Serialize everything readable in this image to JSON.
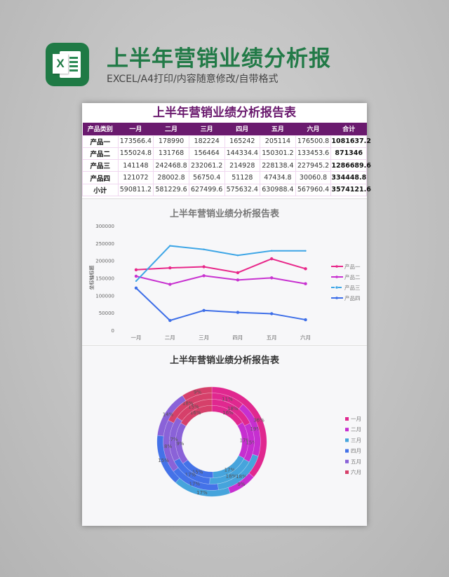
{
  "header": {
    "title": "上半年营销业绩分析报",
    "subtitle": "EXCEL/A4打印/内容随意修改/自带格式",
    "logo_text": "X"
  },
  "table": {
    "title": "上半年营销业绩分析报告表",
    "columns": [
      "产品类别",
      "一月",
      "二月",
      "三月",
      "四月",
      "五月",
      "六月",
      "合计"
    ],
    "rows": [
      [
        "产品一",
        "173566.4",
        "178990",
        "182224",
        "165242",
        "205114",
        "176500.8",
        "1081637.2"
      ],
      [
        "产品二",
        "155024.8",
        "131768",
        "156464",
        "144334.4",
        "150301.2",
        "133453.6",
        "871346"
      ],
      [
        "产品三",
        "141148",
        "242468.8",
        "232061.2",
        "214928",
        "228138.4",
        "227945.2",
        "1286689.6"
      ],
      [
        "产品四",
        "121072",
        "28002.8",
        "56750.4",
        "51128",
        "47434.8",
        "30060.8",
        "334448.8"
      ],
      [
        "小计",
        "590811.2",
        "581229.6",
        "627499.6",
        "575632.4",
        "630988.4",
        "567960.4",
        "3574121.6"
      ]
    ]
  },
  "chart_data": [
    {
      "type": "line",
      "title": "上半年营销业绩分析报告表",
      "ylabel": "坐标轴标题",
      "ylim": [
        0,
        300000
      ],
      "yticks": [
        "0",
        "50000",
        "100000",
        "150000",
        "200000",
        "250000",
        "300000"
      ],
      "categories": [
        "一月",
        "二月",
        "三月",
        "四月",
        "五月",
        "六月"
      ],
      "grid": false,
      "legend": "right",
      "series": [
        {
          "name": "产品一",
          "color": "#e8288a",
          "values": [
            173566.4,
            178990,
            182224,
            165242,
            205114,
            176500.8
          ]
        },
        {
          "name": "产品二",
          "color": "#c832d0",
          "values": [
            155024.8,
            131768,
            156464,
            144334.4,
            150301.2,
            133453.6
          ]
        },
        {
          "name": "产品三",
          "color": "#3ea6e6",
          "dash": true,
          "values": [
            141148,
            242468.8,
            232061.2,
            214928,
            228138.4,
            227945.2
          ]
        },
        {
          "name": "产品四",
          "color": "#3d6ee8",
          "values": [
            121072,
            28002.8,
            56750.4,
            51128,
            47434.8,
            30060.8
          ]
        }
      ]
    },
    {
      "type": "pie",
      "subtype": "multi-ring donut",
      "title": "上半年营销业绩分析报告表",
      "legend": "right",
      "categories": [
        "一月",
        "二月",
        "三月",
        "四月",
        "五月",
        "六月"
      ],
      "colors": [
        "#e0288f",
        "#c62fd0",
        "#46a4dc",
        "#4472e8",
        "#8a62d8",
        "#d6406a"
      ],
      "rings_inner_to_outer": [
        {
          "name": "产品一",
          "labels": [
            "16%",
            "17%",
            "17%",
            "15%",
            "19%",
            "16%"
          ]
        },
        {
          "name": "产品二",
          "labels": [
            "18%",
            "15%",
            "18%",
            "17%",
            "17%",
            "15%"
          ]
        },
        {
          "name": "产品三",
          "labels": [
            "11%",
            "19%",
            "18%",
            "17%",
            "18%",
            "18%"
          ]
        },
        {
          "name": "产品四",
          "labels": [
            "36%",
            "9%",
            "17%",
            "15%",
            "14%",
            "9%"
          ]
        }
      ]
    }
  ]
}
